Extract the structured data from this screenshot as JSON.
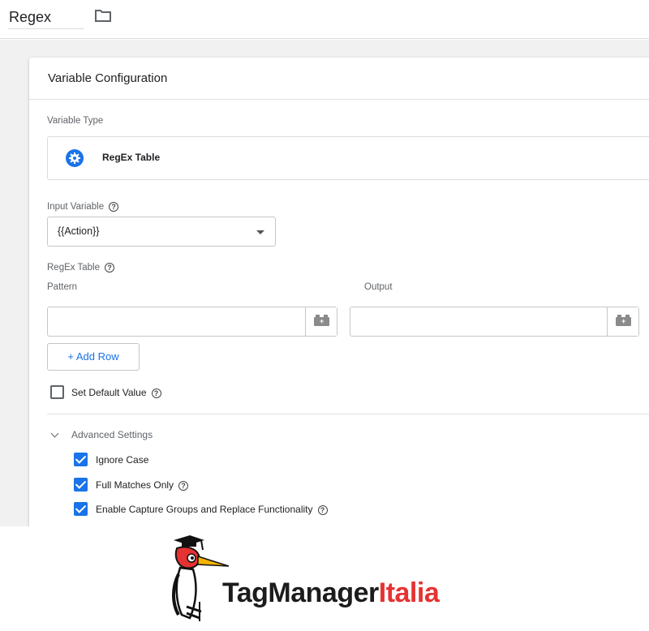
{
  "header": {
    "name": "Regex"
  },
  "card": {
    "title": "Variable Configuration",
    "variable_type_label": "Variable Type",
    "variable_type_name": "RegEx Table",
    "input_variable_label": "Input Variable",
    "input_variable_value": "{{Action}}",
    "regex_table_label": "RegEx Table",
    "pattern_label": "Pattern",
    "output_label": "Output",
    "add_row_label": "+ Add Row",
    "set_default_label": "Set Default Value",
    "set_default_checked": false,
    "advanced_label": "Advanced Settings",
    "options": [
      {
        "label": "Ignore Case",
        "checked": true
      },
      {
        "label": "Full Matches Only",
        "checked": true
      },
      {
        "label": "Enable Capture Groups and Replace Functionality",
        "checked": true
      }
    ]
  },
  "brand": {
    "part1": "TagManager",
    "part2": "Italia"
  },
  "colors": {
    "accent": "#1a73e8",
    "brand_red": "#e63232"
  }
}
